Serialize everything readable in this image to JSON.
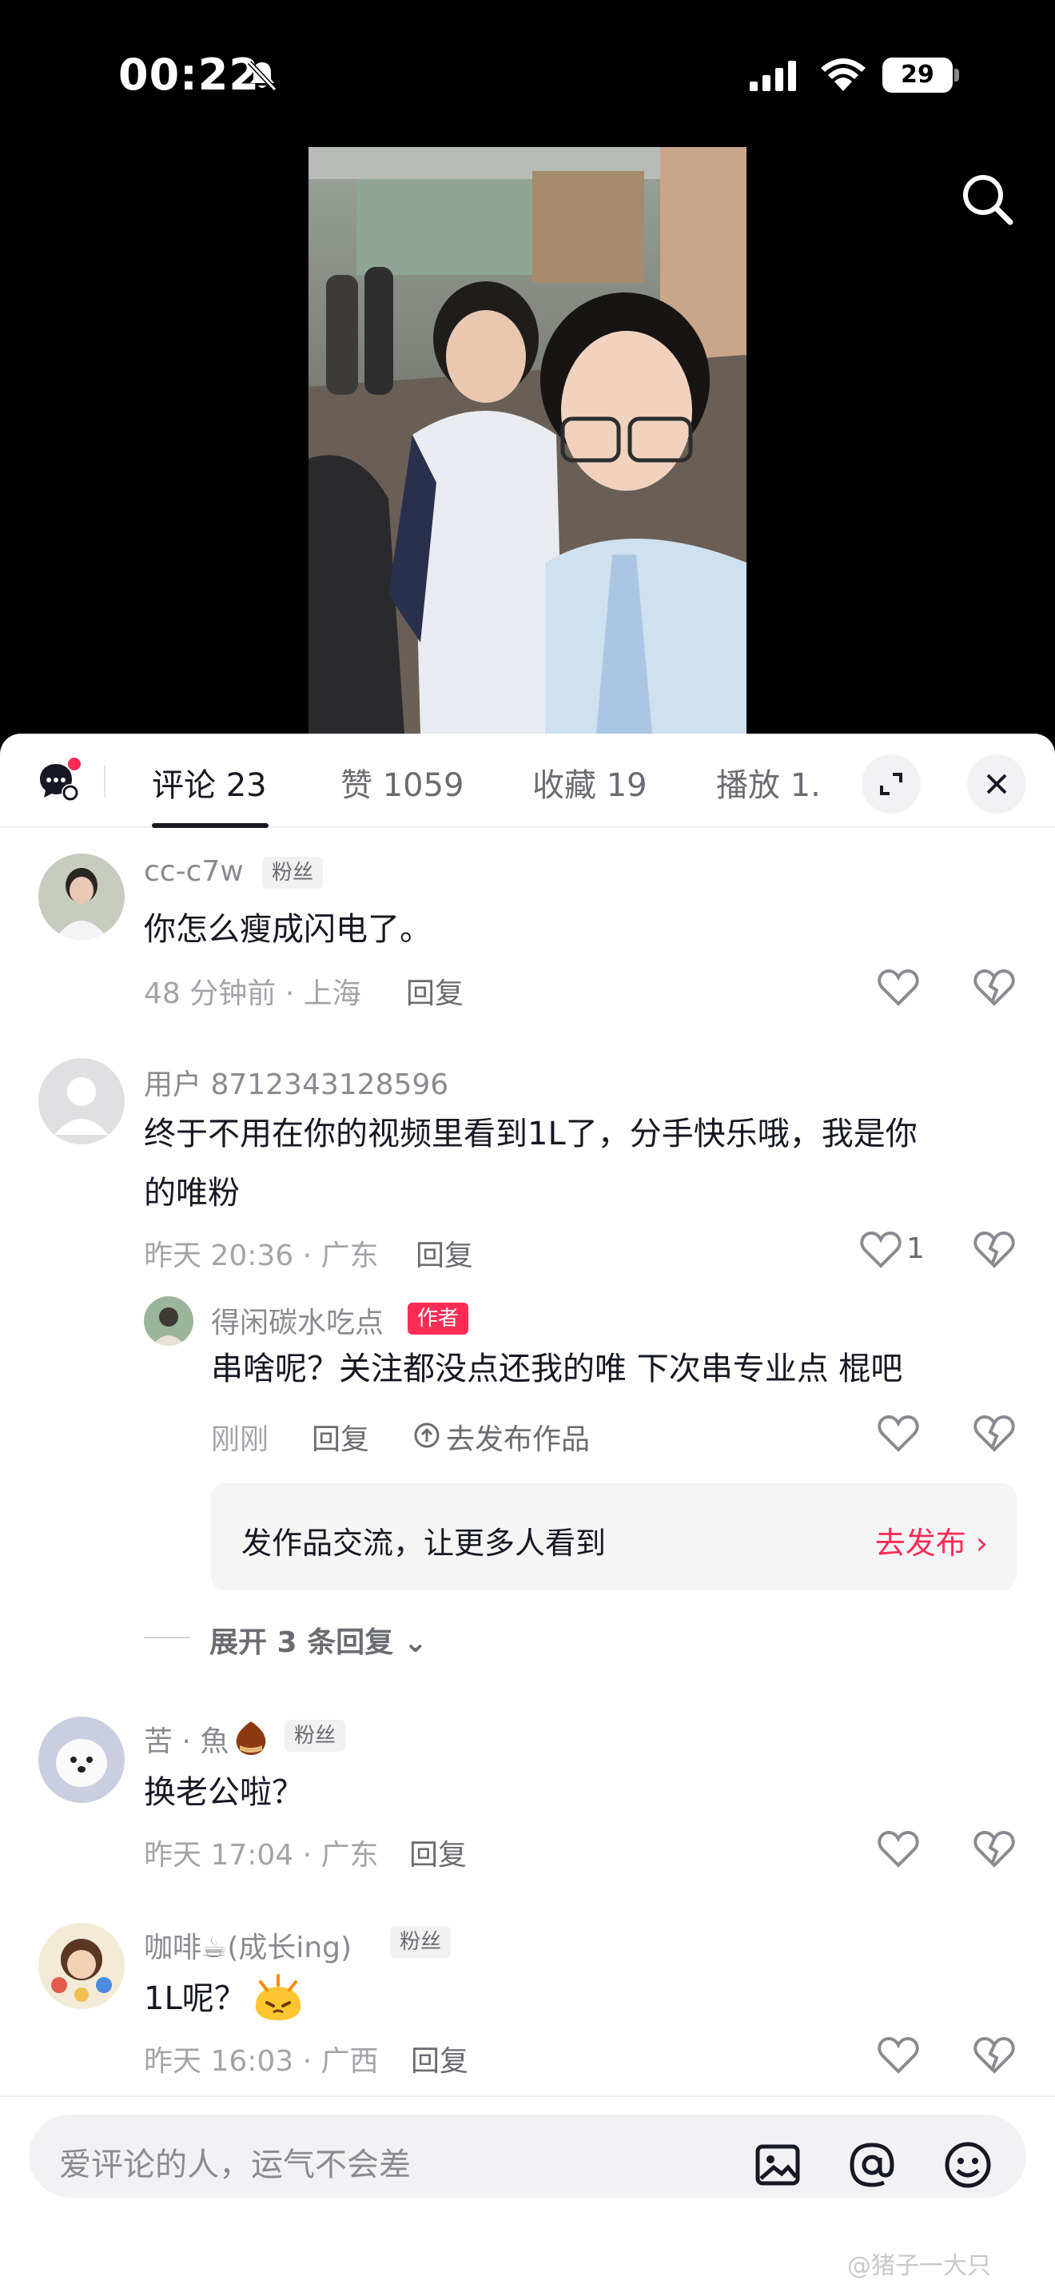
{
  "status_bar": {
    "time": "00:22",
    "battery": "29"
  },
  "comments_panel": {
    "tabs": [
      {
        "label": "评论 23"
      },
      {
        "label": "赞 1059"
      },
      {
        "label": "收藏 19"
      },
      {
        "label": "播放 1."
      }
    ],
    "comments": [
      {
        "username": "cc-c7w",
        "badge": "粉丝",
        "text": "你怎么瘦成闪电了。",
        "meta": "48 分钟前 · 上海",
        "reply_label": "回复"
      },
      {
        "username": "用户 8712343128596",
        "text_line1": "终于不用在你的视频里看到1L了，分手快乐哦，我是你",
        "text_line2": "的唯粉",
        "meta": "昨天 20:36 · 广东",
        "reply_label": "回复",
        "like_count": "1",
        "reply": {
          "username": "得闲碳水吃点",
          "badge": "作者",
          "text": "串啥呢？关注都没点还我的唯 下次串专业点 棍吧",
          "meta": "刚刚",
          "reply_label": "回复",
          "publish_label": "去发布作品"
        }
      },
      {
        "username": "苦 · 魚",
        "badge": "粉丝",
        "text": "换老公啦？",
        "meta": "昨天 17:04 · 广东",
        "reply_label": "回复"
      },
      {
        "username": "咖啡☕(成长ing)",
        "badge": "粉丝",
        "text": "1L呢？",
        "meta": "昨天 16:03 · 广西",
        "reply_label": "回复"
      }
    ],
    "promo": {
      "text": "发作品交流，让更多人看到",
      "link": "去发布 ›"
    },
    "expand_label": "展开 3 条回复 ⌄",
    "input_placeholder": "爱评论的人，运气不会差"
  },
  "watermark": "@猪子一大只",
  "colors": {
    "accent": "#fe2c55",
    "text": "#161823",
    "muted": "#a3a4aa"
  }
}
